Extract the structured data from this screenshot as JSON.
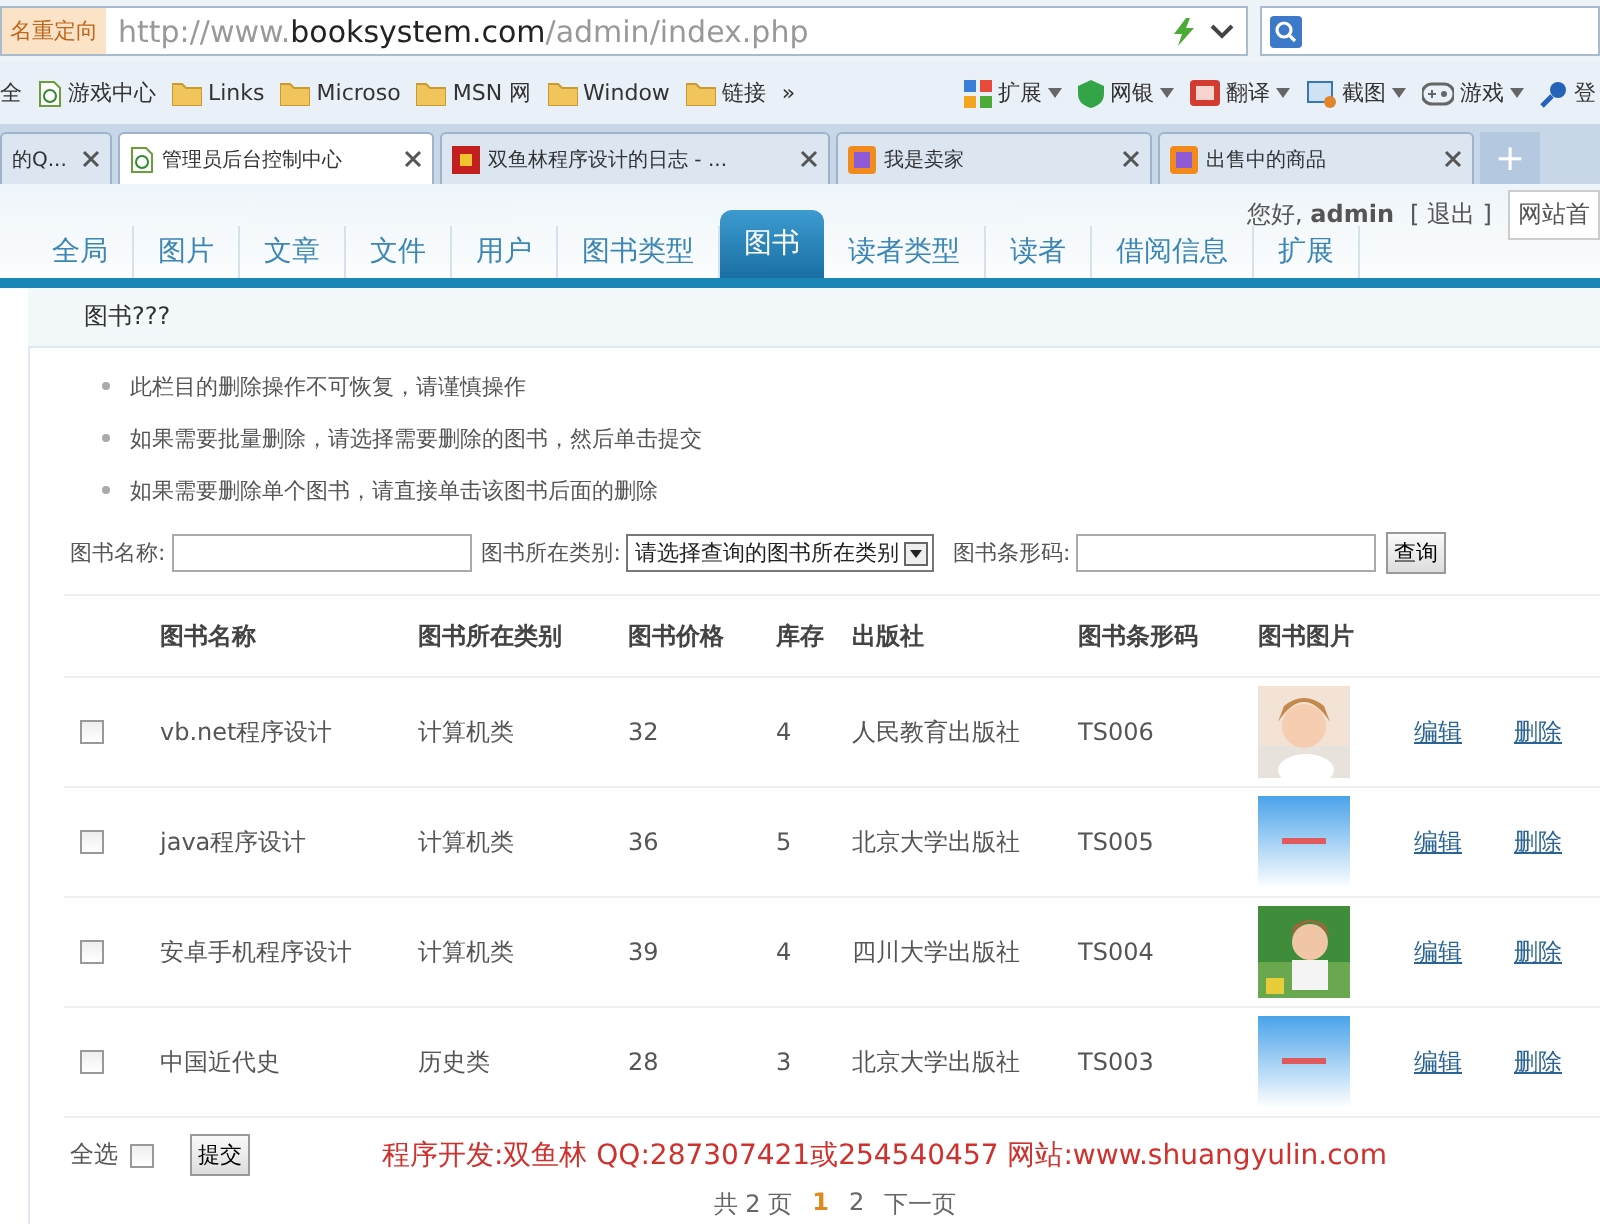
{
  "browser": {
    "redirect_label": "名重定向",
    "url_host_prefix": "http://www.",
    "url_host": "booksystem.com",
    "url_path": "/admin/index.php",
    "bookmarks": [
      {
        "label": "全",
        "kind": "text"
      },
      {
        "label": "游戏中心",
        "kind": "page"
      },
      {
        "label": "Links",
        "kind": "folder"
      },
      {
        "label": "Microso",
        "kind": "folder"
      },
      {
        "label": "MSN 网",
        "kind": "folder"
      },
      {
        "label": "Window",
        "kind": "folder"
      },
      {
        "label": "链接",
        "kind": "folder"
      }
    ],
    "more": "»",
    "tools": [
      {
        "label": "扩展",
        "kind": "grid"
      },
      {
        "label": "网银",
        "kind": "shield"
      },
      {
        "label": "翻译",
        "kind": "book"
      },
      {
        "label": "截图",
        "kind": "crop"
      },
      {
        "label": "游戏",
        "kind": "pad"
      },
      {
        "label": "登",
        "kind": "key"
      }
    ],
    "tabs": [
      {
        "label": "的Q...",
        "selected": false,
        "kind": "none"
      },
      {
        "label": "管理员后台控制中心",
        "selected": true,
        "kind": "page"
      },
      {
        "label": "双鱼林程序设计的日志 - ...",
        "selected": false,
        "kind": "fish"
      },
      {
        "label": "我是卖家",
        "selected": false,
        "kind": "shop"
      },
      {
        "label": "出售中的商品",
        "selected": false,
        "kind": "shop"
      }
    ],
    "new_tab": "+"
  },
  "header": {
    "greeting": "您好,",
    "user": "admin",
    "logout": "[ 退出 ]",
    "site_link": "网站首"
  },
  "nav": [
    {
      "label": "全局",
      "selected": false
    },
    {
      "label": "图片",
      "selected": false
    },
    {
      "label": "文章",
      "selected": false
    },
    {
      "label": "文件",
      "selected": false
    },
    {
      "label": "用户",
      "selected": false
    },
    {
      "label": "图书类型",
      "selected": false
    },
    {
      "label": "图书",
      "selected": true
    },
    {
      "label": "读者类型",
      "selected": false
    },
    {
      "label": "读者",
      "selected": false
    },
    {
      "label": "借阅信息",
      "selected": false
    },
    {
      "label": "扩展",
      "selected": false
    }
  ],
  "breadcrumb": "图书???",
  "notes": [
    "此栏目的删除操作不可恢复，请谨慎操作",
    "如果需要批量删除，请选择需要删除的图书，然后单击提交",
    "如果需要删除单个图书，请直接单击该图书后面的删除"
  ],
  "search": {
    "name_label": "图书名称:",
    "category_label": "图书所在类别:",
    "category_value": "请选择查询的图书所在类别",
    "barcode_label": "图书条形码:",
    "button": "查询"
  },
  "table": {
    "columns": [
      "图书名称",
      "图书所在类别",
      "图书价格",
      "库存",
      "出版社",
      "图书条形码",
      "图书图片"
    ],
    "rows": [
      {
        "checked": false,
        "name": "vb.net程序设计",
        "category": "计算机类",
        "price": "32",
        "stock": "4",
        "publisher": "人民教育出版社",
        "barcode": "TS006",
        "edit": "编辑",
        "delete": "删除"
      },
      {
        "checked": false,
        "name": "java程序设计",
        "category": "计算机类",
        "price": "36",
        "stock": "5",
        "publisher": "北京大学出版社",
        "barcode": "TS005",
        "edit": "编辑",
        "delete": "删除"
      },
      {
        "checked": false,
        "name": "安卓手机程序设计",
        "category": "计算机类",
        "price": "39",
        "stock": "4",
        "publisher": "四川大学出版社",
        "barcode": "TS004",
        "edit": "编辑",
        "delete": "删除"
      },
      {
        "checked": false,
        "name": "中国近代史",
        "category": "历史类",
        "price": "28",
        "stock": "3",
        "publisher": "北京大学出版社",
        "barcode": "TS003",
        "edit": "编辑",
        "delete": "删除"
      }
    ]
  },
  "footer": {
    "select_all": "全选",
    "select_all_checked": false,
    "submit": "提交",
    "credit": "程序开发:双鱼林 QQ:287307421或254540457 网站:www.shuangyulin.com"
  },
  "pagination": {
    "total": "共 2 页",
    "pages": [
      {
        "label": "1",
        "selected": true
      },
      {
        "label": "2",
        "selected": false
      }
    ],
    "next": "下一页"
  }
}
